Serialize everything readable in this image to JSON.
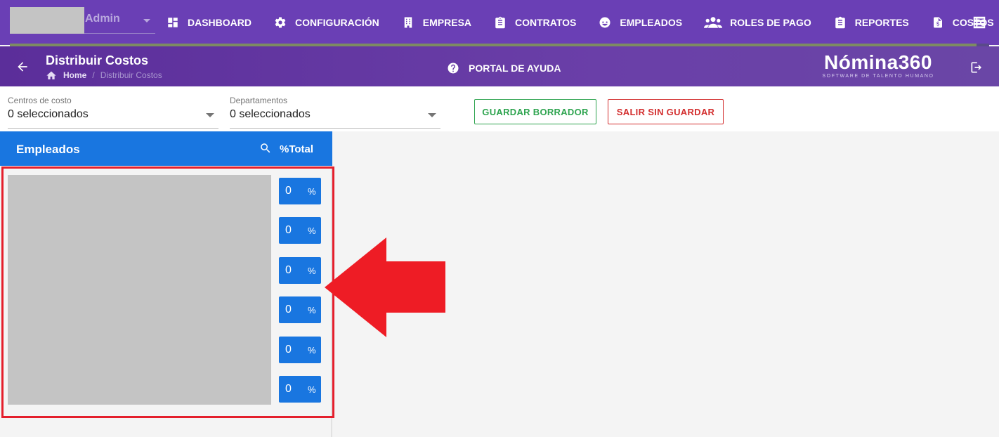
{
  "user": {
    "name": "Admin"
  },
  "nav": {
    "items": [
      {
        "label": "DASHBOARD",
        "icon": "dashboard-icon"
      },
      {
        "label": "CONFIGURACIÓN",
        "icon": "gear-icon"
      },
      {
        "label": "EMPRESA",
        "icon": "building-icon"
      },
      {
        "label": "CONTRATOS",
        "icon": "clipboard-icon"
      },
      {
        "label": "EMPLEADOS",
        "icon": "face-icon"
      },
      {
        "label": "ROLES DE PAGO",
        "icon": "people-icon"
      },
      {
        "label": "REPORTES",
        "icon": "report-icon"
      },
      {
        "label": "COSTOS",
        "icon": "invoice-icon"
      }
    ],
    "progress": 0.987
  },
  "header": {
    "title": "Distribuir Costos",
    "breadcrumb": {
      "home": "Home",
      "separator": "/",
      "current": "Distribuir Costos"
    },
    "help": "PORTAL DE AYUDA",
    "brand": {
      "name": "Nómina360",
      "tagline": "SOFTWARE DE TALENTO HUMANO"
    }
  },
  "filters": {
    "cost_centers": {
      "label": "Centros de costo",
      "value": "0 seleccionados"
    },
    "departments": {
      "label": "Departamentos",
      "value": "0 seleccionados"
    }
  },
  "actions": {
    "save_draft": "GUARDAR BORRADOR",
    "exit": "SALIR SIN GUARDAR"
  },
  "panel": {
    "title": "Empleados",
    "total_label": "%Total",
    "rows": [
      {
        "value": "0",
        "unit": "%"
      },
      {
        "value": "0",
        "unit": "%"
      },
      {
        "value": "0",
        "unit": "%"
      },
      {
        "value": "0",
        "unit": "%"
      },
      {
        "value": "0",
        "unit": "%"
      },
      {
        "value": "0",
        "unit": "%"
      }
    ]
  },
  "colors": {
    "nav_bg": "#6a3fb5",
    "panel_blue": "#1976e0",
    "highlight_red": "#e41f2c",
    "save_green": "#2ea44f",
    "exit_red": "#d32f2f"
  }
}
